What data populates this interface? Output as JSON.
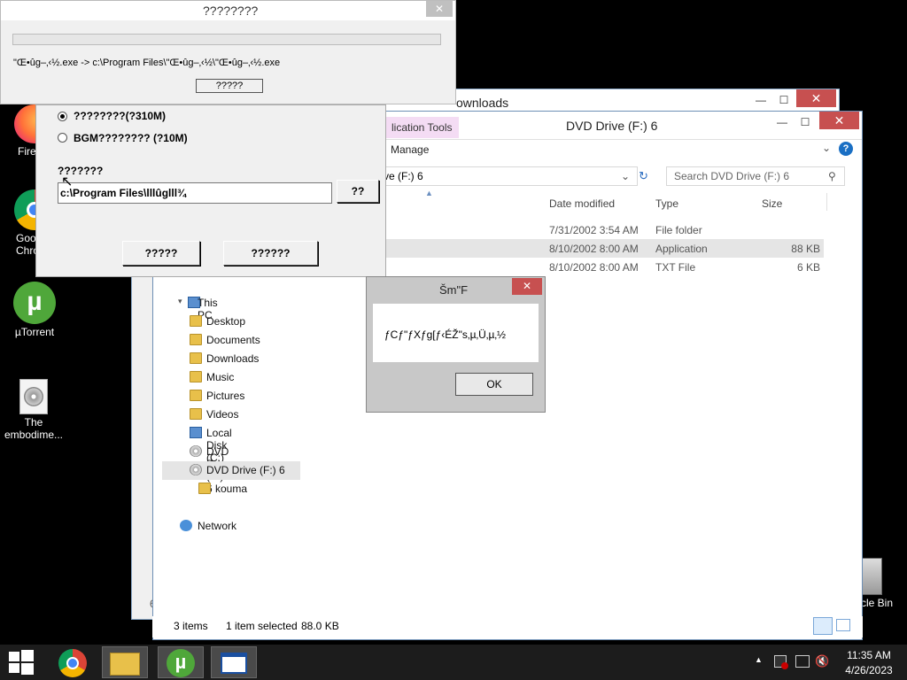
{
  "desktop": {
    "icons": [
      {
        "label": "Fire"
      },
      {
        "label": "Goo\nChro"
      },
      {
        "label": "µTorrent"
      },
      {
        "label": "The\nembodime..."
      },
      {
        "label": "cle Bin"
      }
    ]
  },
  "explorer_back": {
    "title": "ownloads"
  },
  "explorer_front": {
    "title": "DVD Drive (F:) 6",
    "ribbon_tab": "lication Tools",
    "ribbon_manage": "Manage",
    "address": "ve (F:) 6",
    "search_placeholder": "Search DVD Drive (F:) 6",
    "columns": {
      "date": "Date modified",
      "type": "Type",
      "size": "Size"
    },
    "rows": [
      {
        "date": "7/31/2002 3:54 AM",
        "type": "File folder",
        "size": ""
      },
      {
        "date": "8/10/2002 8:00 AM",
        "type": "Application",
        "size": "88 KB"
      },
      {
        "date": "8/10/2002 8:00 AM",
        "type": "TXT File",
        "size": "6 KB"
      }
    ],
    "nav": {
      "this_pc": "This PC",
      "desktop": "Desktop",
      "documents": "Documents",
      "downloads": "Downloads",
      "music": "Music",
      "pictures": "Pictures",
      "videos": "Videos",
      "local_disk": "Local Disk (C:)",
      "dvd_e": "DVD Drive (E:) 6",
      "dvd_f": "DVD Drive (F:) 6",
      "kouma": "kouma",
      "network": "Network"
    },
    "status": {
      "items": "3 items",
      "selected": "1 item selected",
      "size": "88.0 KB"
    },
    "left_fragment": "6"
  },
  "installer": {
    "option1": "????????(?310M)",
    "option2": "BGM???????? (?10M)",
    "dest_label": "???????",
    "dest_path": "c:\\Program Files\\lllûglll¾",
    "browse": "??",
    "btn_install": "?????",
    "btn_cancel": "??????"
  },
  "progress": {
    "title": "????????",
    "message": "\"Œ•ûg–‚‹½.exe -> c:\\Program Files\\\"Œ•ûg–‚‹½\\\"Œ•ûg–‚‹½.exe",
    "cancel": "?????",
    "progress_percent": 0
  },
  "msgbox": {
    "title": "Šm\"F",
    "message": "ƒCƒ\"ƒXƒg[ƒ‹ÉŽ\"s‚µ‚Ü‚µ‚½",
    "ok": "OK"
  },
  "taskbar": {
    "time": "11:35 AM",
    "date": "4/26/2023"
  }
}
